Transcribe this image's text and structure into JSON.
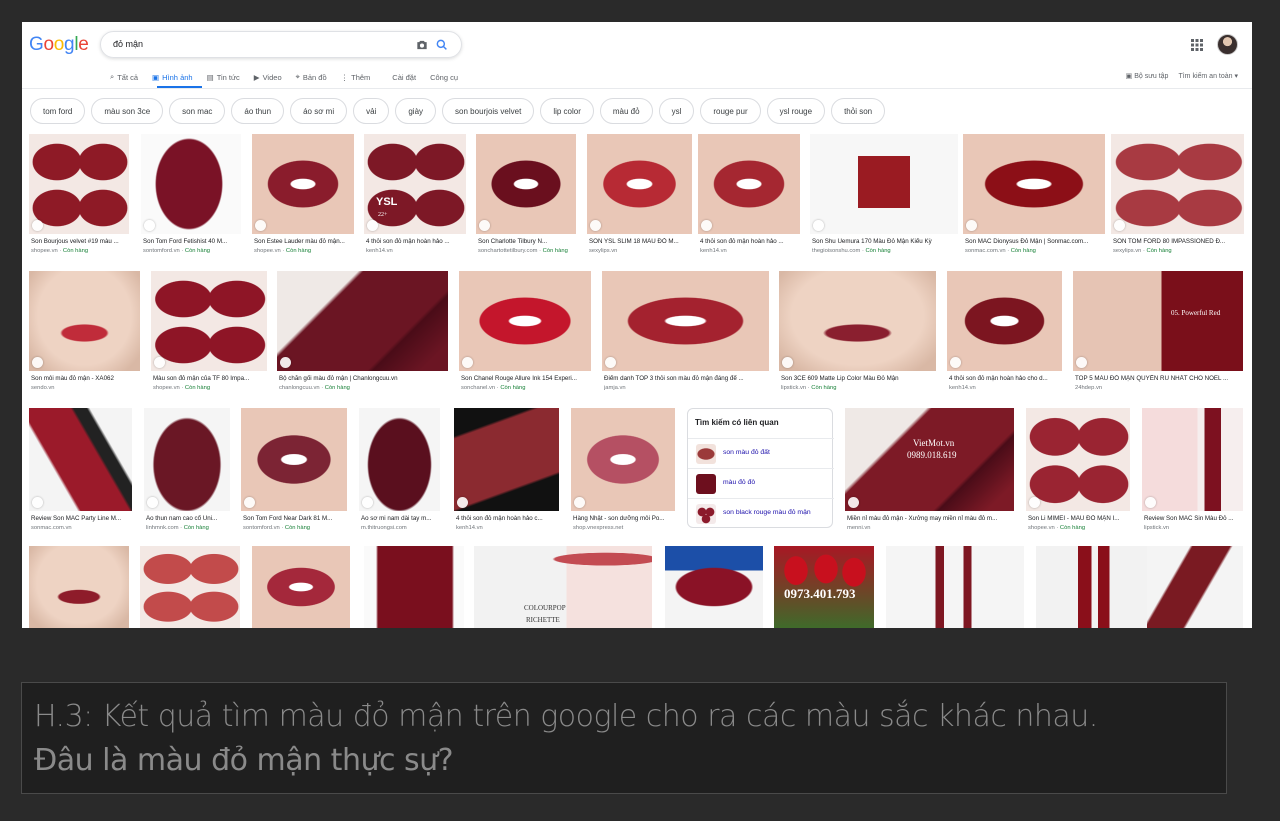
{
  "logo": {
    "text": "Google",
    "colors": [
      "#4285f4",
      "#ea4335",
      "#fbbc05",
      "#4285f4",
      "#34a853",
      "#ea4335"
    ]
  },
  "search": {
    "query": "đỏ mận"
  },
  "tabs": [
    {
      "label": "Tất cả",
      "icon": "search-icon"
    },
    {
      "label": "Hình ảnh",
      "icon": "image-icon",
      "active": true
    },
    {
      "label": "Tin tức",
      "icon": "news-icon"
    },
    {
      "label": "Video",
      "icon": "video-icon"
    },
    {
      "label": "Bản đồ",
      "icon": "map-pin-icon"
    },
    {
      "label": "Thêm",
      "icon": "more-vertical-icon"
    },
    {
      "label": "Cài đặt"
    },
    {
      "label": "Công cụ"
    }
  ],
  "right_links": {
    "collections": "Bộ sưu tập",
    "safe_search": "Tìm kiếm an toàn ▾"
  },
  "chips": [
    "tom ford",
    "màu son 3ce",
    "son mac",
    "áo thun",
    "áo sơ mi",
    "vải",
    "giày",
    "son bourjois velvet",
    "lip color",
    "màu đỏ",
    "ysl",
    "rouge pur",
    "ysl rouge",
    "thỏi son"
  ],
  "results": {
    "row1": [
      {
        "title": "Son Bourjous velvet #19 màu ...",
        "source": "shopee.vn",
        "stock": "Còn hàng"
      },
      {
        "title": "Son Tom Ford Fetishist 40 M...",
        "source": "sontomford.vn",
        "stock": "Còn hàng"
      },
      {
        "title": "Son Estee Lauder màu đỏ mận...",
        "source": "shopee.vn",
        "stock": "Còn hàng"
      },
      {
        "title": "4 thỏi son đỏ mận hoàn hảo ...",
        "source": "kenh14.vn",
        "stock": ""
      },
      {
        "title": "Son Charlotte Tilbury N...",
        "source": "sonchartottetilbury.com",
        "stock": "Còn hàng"
      },
      {
        "title": "SON YSL SLIM 18 MÀU ĐỎ M...",
        "source": "sexylips.vn",
        "stock": ""
      },
      {
        "title": "4 thỏi son đỏ mận hoàn hảo ...",
        "source": "kenh14.vn",
        "stock": ""
      },
      {
        "title": "Son Shu Uemura 170 Màu Đỏ Mận Kiểu Kỳ",
        "source": "thegioisonshu.com",
        "stock": "Còn hàng"
      },
      {
        "title": "Son MAC Dionysus Đỏ Mận | Sonmac.com...",
        "source": "sonmac.com.vn",
        "stock": "Còn hàng"
      },
      {
        "title": "SON TOM FORD 80 IMPASSIONED Đ...",
        "source": "sexylips.vn",
        "stock": "Còn hàng"
      }
    ],
    "row2": [
      {
        "title": "Son môi màu đỏ mận - XA062",
        "source": "sendo.vn",
        "stock": ""
      },
      {
        "title": "Màu son đỏ mận của TF 80 Impa...",
        "source": "shopee.vn",
        "stock": "Còn hàng"
      },
      {
        "title": "Bộ chăn gối màu đỏ mận | Chanlongcuu.vn",
        "source": "chanlongcuu.vn",
        "stock": "Còn hàng"
      },
      {
        "title": "Son Chanel Rouge Allure Ink 154 Experi...",
        "source": "sonchanel.vn",
        "stock": "Còn hàng"
      },
      {
        "title": "Điểm danh TOP 3 thỏi son màu đỏ mận đáng để ...",
        "source": "jamja.vn",
        "stock": ""
      },
      {
        "title": "Son 3CE 609 Matte Lip Color Màu Đỏ Mận",
        "source": "lipstick.vn",
        "stock": "Còn hàng"
      },
      {
        "title": "4 thỏi son đỏ mận hoàn hảo cho d...",
        "source": "kenh14.vn",
        "stock": ""
      },
      {
        "title": "TOP 5 MÀU ĐỎ MẬN QUYẾN RŨ NHẤT CHO NOEL ...",
        "source": "24hdep.vn",
        "stock": ""
      }
    ],
    "row3": [
      {
        "title": "Review Son MAC Party Line M...",
        "source": "sonmac.com.vn",
        "stock": ""
      },
      {
        "title": "Áo thun nam cao cổ Uni...",
        "source": "linhmnk.com",
        "stock": "Còn hàng"
      },
      {
        "title": "Son Tom Ford Near Dark 81 M...",
        "source": "sontomford.vn",
        "stock": "Còn hàng"
      },
      {
        "title": "Áo sơ mi nam dài tay m...",
        "source": "m.thitruongsi.com",
        "stock": ""
      },
      {
        "title": "4 thỏi son đỏ mận hoàn hảo c...",
        "source": "kenh14.vn",
        "stock": ""
      },
      {
        "title": "Hàng Nhật - son dưỡng môi Po...",
        "source": "shop.vnexpress.net",
        "stock": ""
      },
      {
        "title": "Miền nỉ màu đỏ mận - Xưởng may miền nỉ màu đỏ m...",
        "source": "menni.vn",
        "stock": ""
      },
      {
        "title": "Son Li MIMEI - MÀU ĐỎ MẬN I...",
        "source": "shopee.vn",
        "stock": "Còn hàng"
      },
      {
        "title": "Review Son MAC Sin Màu Đỏ ...",
        "source": "lipstick.vn",
        "stock": ""
      }
    ]
  },
  "overlays": {
    "ysl": "YSL",
    "ysl_code": "22+",
    "powerful_red": "05. Powerful Red",
    "vietmot_name": "VietMot.vn",
    "vietmot_phone": "0989.018.619",
    "tulip_phone": "0973.401.793",
    "colourpop_brand": "COLOURPOP",
    "colourpop_shade": "RICHETTE"
  },
  "related": {
    "title": "Tìm kiếm có liên quan",
    "items": [
      "son màu đỏ đất",
      "màu đỏ đô",
      "son black rouge màu đỏ mận"
    ]
  },
  "caption": {
    "line1": "H.3: Kết quả tìm màu đỏ mận trên google cho ra các màu sắc khác nhau.",
    "line2": "Đâu là màu đỏ mận thực sự?"
  },
  "colors": {
    "accent": "#1a73e8",
    "plum": "#7a1226",
    "stock_green": "#188038"
  }
}
